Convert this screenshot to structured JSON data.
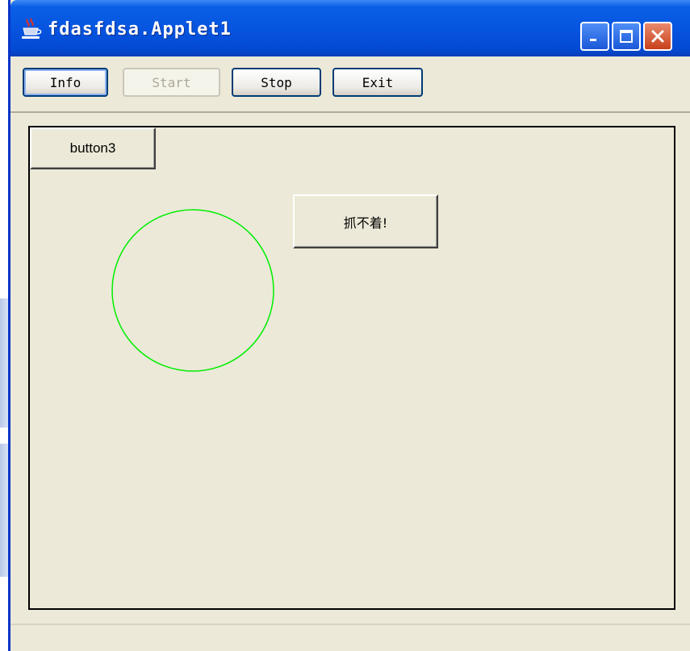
{
  "window": {
    "title": "fdasfdsa.Applet1",
    "icon": "java-cup-icon",
    "controls": {
      "minimize": "minimize-icon",
      "maximize": "maximize-icon",
      "close": "close-icon"
    }
  },
  "toolbar": {
    "info_label": "Info",
    "start_label": "Start",
    "stop_label": "Stop",
    "exit_label": "Exit"
  },
  "applet": {
    "button3_label": "button3",
    "catch_button_label": "抓不着!",
    "circle_color": "#00ee00"
  },
  "colors": {
    "titlebar": "#0655e0",
    "window_bg": "#ece9d8",
    "button_border": "#003c74"
  }
}
